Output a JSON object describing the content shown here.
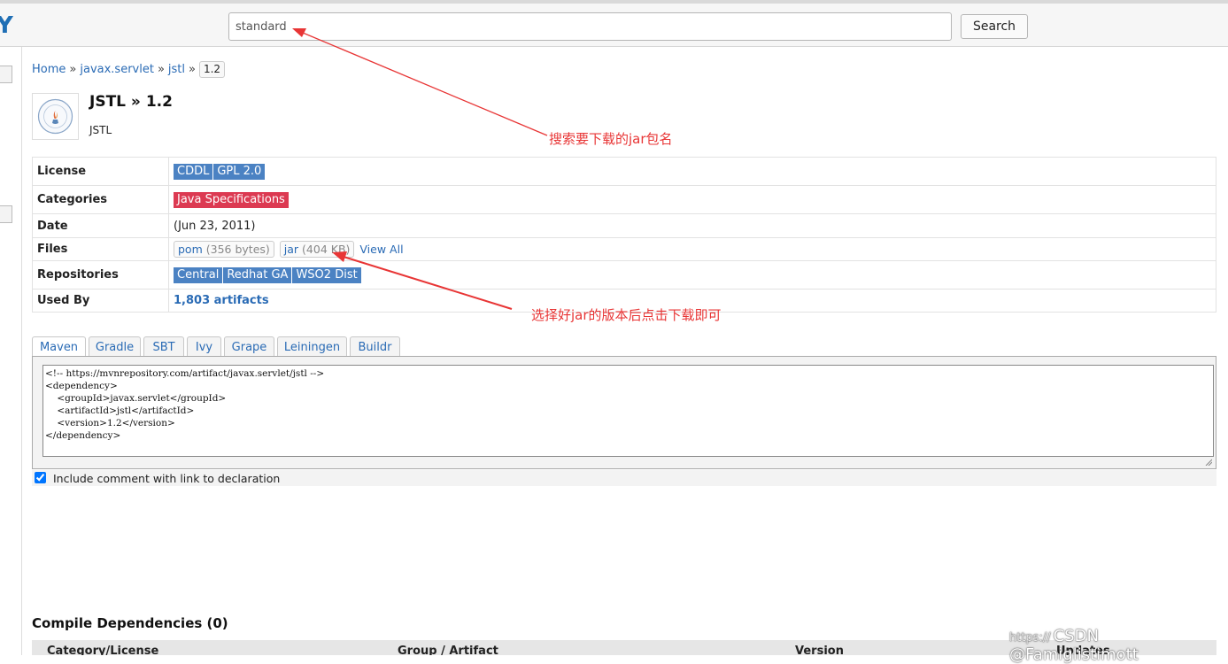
{
  "topbar": {
    "logo_fragment": "Y",
    "search_value": "standard",
    "search_button": "Search"
  },
  "breadcrumb": {
    "home": "Home",
    "sep": "»",
    "group": "javax.servlet",
    "artifact": "jstl",
    "version": "1.2"
  },
  "artifact": {
    "title": "JSTL » 1.2",
    "subtitle": "JSTL"
  },
  "info": {
    "license": {
      "label": "License",
      "badges": [
        "CDDL",
        "GPL 2.0"
      ]
    },
    "categories": {
      "label": "Categories",
      "badges": [
        "Java Specifications"
      ]
    },
    "date": {
      "label": "Date",
      "value": "(Jun 23, 2011)"
    },
    "files": {
      "label": "Files",
      "pom": {
        "name": "pom",
        "size": "(356 bytes)"
      },
      "jar": {
        "name": "jar",
        "size": "(404 KB)"
      },
      "view_all": "View All"
    },
    "repositories": {
      "label": "Repositories",
      "badges": [
        "Central",
        "Redhat GA",
        "WSO2 Dist"
      ]
    },
    "used_by": {
      "label": "Used By",
      "value": "1,803 artifacts"
    }
  },
  "tabs": [
    "Maven",
    "Gradle",
    "SBT",
    "Ivy",
    "Grape",
    "Leiningen",
    "Buildr"
  ],
  "active_tab": "Maven",
  "snippet": "<!-- https://mvnrepository.com/artifact/javax.servlet/jstl -->\n<dependency>\n    <groupId>javax.servlet</groupId>\n    <artifactId>jstl</artifactId>\n    <version>1.2</version>\n</dependency>",
  "include_comment": {
    "checked": true,
    "label": "Include comment with link to declaration"
  },
  "compile_deps": {
    "title": "Compile Dependencies (0)",
    "columns": [
      "Category/License",
      "Group / Artifact",
      "Version",
      "Updates"
    ]
  },
  "annotations": {
    "search_note": "搜索要下载的jar包名",
    "jar_note": "选择好jar的版本后点击下载即可"
  },
  "watermark": {
    "prefix": "https://",
    "text": "CSDN @Famiglistimott"
  },
  "colors": {
    "badge_blue": "#4b82c3",
    "badge_red": "#dc3a52",
    "link": "#2a6bb5",
    "annotation": "#e83535"
  }
}
